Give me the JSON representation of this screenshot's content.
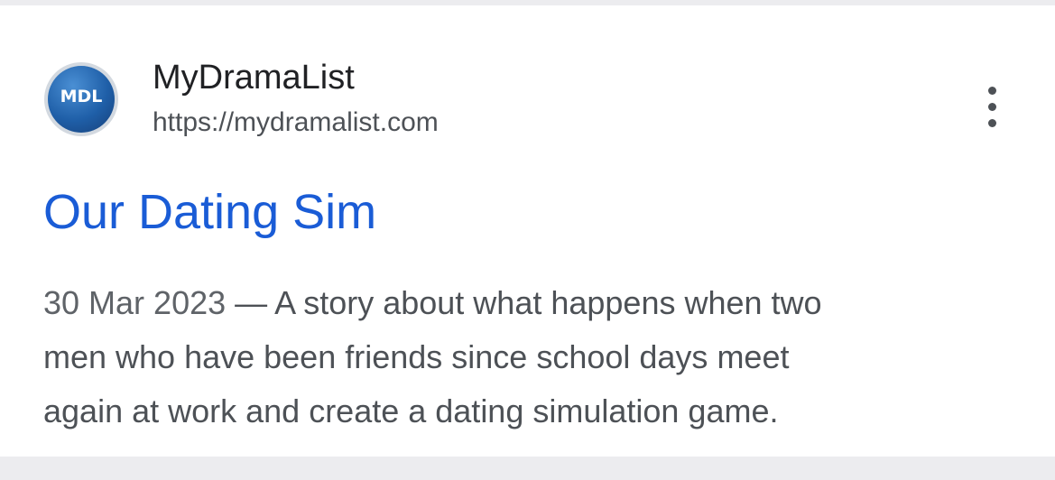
{
  "result": {
    "favicon_text": "MDL",
    "site_name": "MyDramaList",
    "url": "https://mydramalist.com",
    "menu_icon": "more-vert-icon",
    "title": "Our Dating Sim",
    "date": "30 Mar 2023",
    "separator": " — ",
    "snippet_lines": [
      "A story about what happens when two",
      "men who have been friends since school days meet",
      "again at work and create a dating simulation game."
    ]
  },
  "colors": {
    "title_link": "#1a5cd6",
    "body_text": "#4d5156",
    "background": "#ececef"
  }
}
